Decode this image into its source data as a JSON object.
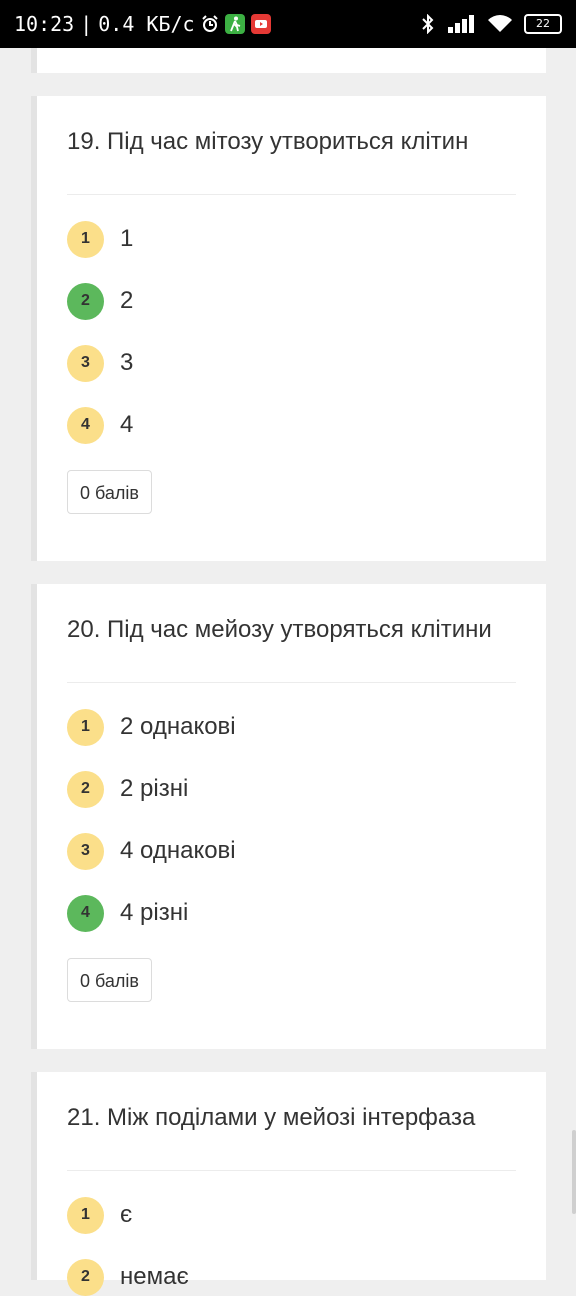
{
  "status_bar": {
    "time": "10:23",
    "separator": "|",
    "net_speed": "0.4 КБ/с",
    "battery": "22",
    "icons": [
      "alarm-icon",
      "walking-app-icon",
      "youtube-icon",
      "bluetooth-icon",
      "signal-icon",
      "wifi-icon",
      "battery-icon"
    ]
  },
  "questions": [
    {
      "title": "19. Під час мітозу утвориться клітин",
      "options": [
        {
          "num": "1",
          "text": "1",
          "correct": false
        },
        {
          "num": "2",
          "text": "2",
          "correct": true
        },
        {
          "num": "3",
          "text": "3",
          "correct": false
        },
        {
          "num": "4",
          "text": "4",
          "correct": false
        }
      ],
      "score": "0 балів"
    },
    {
      "title": "20. Під час мейозу утворяться клітини",
      "options": [
        {
          "num": "1",
          "text": "2 однакові",
          "correct": false
        },
        {
          "num": "2",
          "text": "2 різні",
          "correct": false
        },
        {
          "num": "3",
          "text": "4 однакові",
          "correct": false
        },
        {
          "num": "4",
          "text": "4 різні",
          "correct": true
        }
      ],
      "score": "0 балів"
    },
    {
      "title": "21. Між поділами у мейозі інтерфаза",
      "options": [
        {
          "num": "1",
          "text": "є",
          "correct": false
        },
        {
          "num": "2",
          "text": "немає",
          "correct": false
        }
      ]
    }
  ],
  "colors": {
    "option_badge": "#fbdf8a",
    "correct_badge": "#5cb85c",
    "card_border": "#e3e3e3",
    "background": "#efefef"
  }
}
